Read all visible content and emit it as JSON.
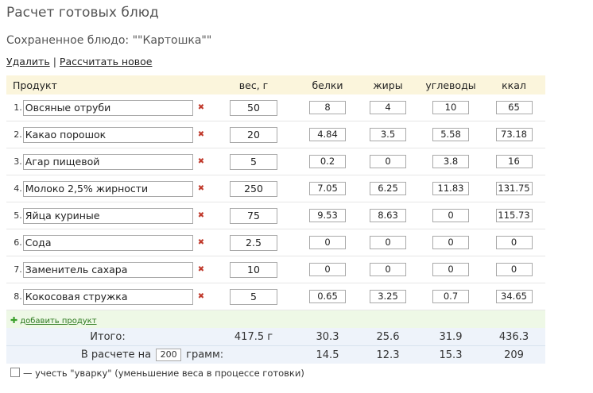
{
  "title": "Расчет готовых блюд",
  "saved_dish": "Сохраненное блюдо: \"\"Картошка\"\"",
  "actions": {
    "delete": "Удалить",
    "separator": "|",
    "new_calc": "Рассчитать новое"
  },
  "headers": {
    "product": "Продукт",
    "weight": "вес, г",
    "protein": "белки",
    "fat": "жиры",
    "carbs": "углеводы",
    "kcal": "ккал"
  },
  "rows": [
    {
      "num": "1.",
      "name": "Овсяные отруби",
      "weight": "50",
      "protein": "8",
      "fat": "4",
      "carbs": "10",
      "kcal": "65"
    },
    {
      "num": "2.",
      "name": "Какао порошок",
      "weight": "20",
      "protein": "4.84",
      "fat": "3.5",
      "carbs": "5.58",
      "kcal": "73.18"
    },
    {
      "num": "3.",
      "name": "Агар пищевой",
      "weight": "5",
      "protein": "0.2",
      "fat": "0",
      "carbs": "3.8",
      "kcal": "16"
    },
    {
      "num": "4.",
      "name": "Молоко 2,5% жирности",
      "weight": "250",
      "protein": "7.05",
      "fat": "6.25",
      "carbs": "11.83",
      "kcal": "131.75"
    },
    {
      "num": "5.",
      "name": "Яйца куриные",
      "weight": "75",
      "protein": "9.53",
      "fat": "8.63",
      "carbs": "0",
      "kcal": "115.73"
    },
    {
      "num": "6.",
      "name": "Сода",
      "weight": "2.5",
      "protein": "0",
      "fat": "0",
      "carbs": "0",
      "kcal": "0"
    },
    {
      "num": "7.",
      "name": "Заменитель сахара",
      "weight": "10",
      "protein": "0",
      "fat": "0",
      "carbs": "0",
      "kcal": "0"
    },
    {
      "num": "8.",
      "name": "Кокосовая стружка",
      "weight": "5",
      "protein": "0.65",
      "fat": "3.25",
      "carbs": "0.7",
      "kcal": "34.65"
    }
  ],
  "add_product": "добавить продукт",
  "total": {
    "label": "Итого:",
    "weight": "417.5 г",
    "protein": "30.3",
    "fat": "25.6",
    "carbs": "31.9",
    "kcal": "436.3"
  },
  "portion": {
    "label_before": "В расчете на",
    "grams": "200",
    "label_after": "грамм:",
    "protein": "14.5",
    "fat": "12.3",
    "carbs": "15.3",
    "kcal": "209"
  },
  "boil_label": "— учесть \"уварку\" (уменьшение веса в процессе готовки)",
  "icons": {
    "delete": "delete-x-icon",
    "add": "plus-icon"
  },
  "colors": {
    "header_bg": "#fbf5dc",
    "add_row_bg": "#eef8e6",
    "total_bg": "#eef3fa",
    "delete_icon": "#c0392b"
  }
}
